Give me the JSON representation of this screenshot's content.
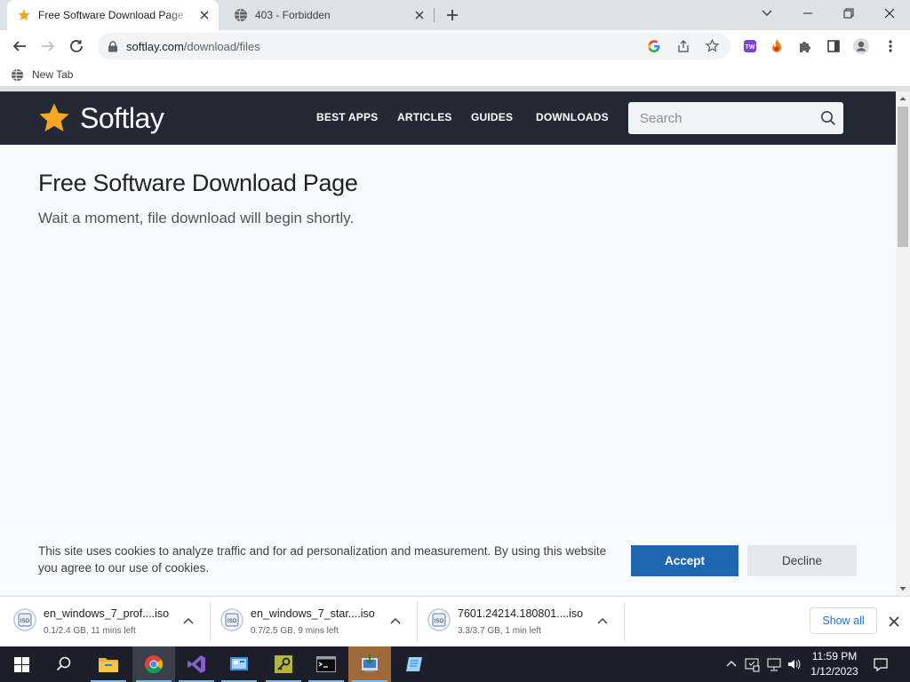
{
  "browser": {
    "tabs": [
      {
        "title": "Free Software Download Page - Softlay",
        "active": true
      },
      {
        "title": "403 - Forbidden",
        "active": false
      }
    ],
    "url_domain": "softlay.com",
    "url_path": "/download/files",
    "bookmarks": [
      {
        "label": "New Tab"
      }
    ]
  },
  "site": {
    "logo": "Softlay",
    "nav": [
      "BEST APPS",
      "ARTICLES",
      "GUIDES",
      "DOWNLOADS"
    ],
    "search_placeholder": "Search",
    "title": "Free Software Download Page",
    "subtitle": "Wait a moment, file download will begin shortly.",
    "cookie": {
      "text": "This site uses cookies to analyze traffic and for ad personalization and measurement. By using this website you agree to our use of cookies.",
      "accept": "Accept",
      "decline": "Decline"
    }
  },
  "downloads": {
    "items": [
      {
        "name": "en_windows_7_prof....iso",
        "status": "0.1/2.4 GB, 11 mins left"
      },
      {
        "name": "en_windows_7_star....iso",
        "status": "0.7/2.5 GB, 9 mins left"
      },
      {
        "name": "7601.24214.180801....iso",
        "status": "3.3/3.7 GB, 1 min left"
      }
    ],
    "show_all": "Show all"
  },
  "taskbar": {
    "time": "11:59 PM",
    "date": "1/12/2023"
  },
  "colors": {
    "header_bg": "#232a35",
    "accept_bg": "#1f67b1",
    "logo_star": "#f5a623",
    "link_blue": "#1a73e8"
  }
}
